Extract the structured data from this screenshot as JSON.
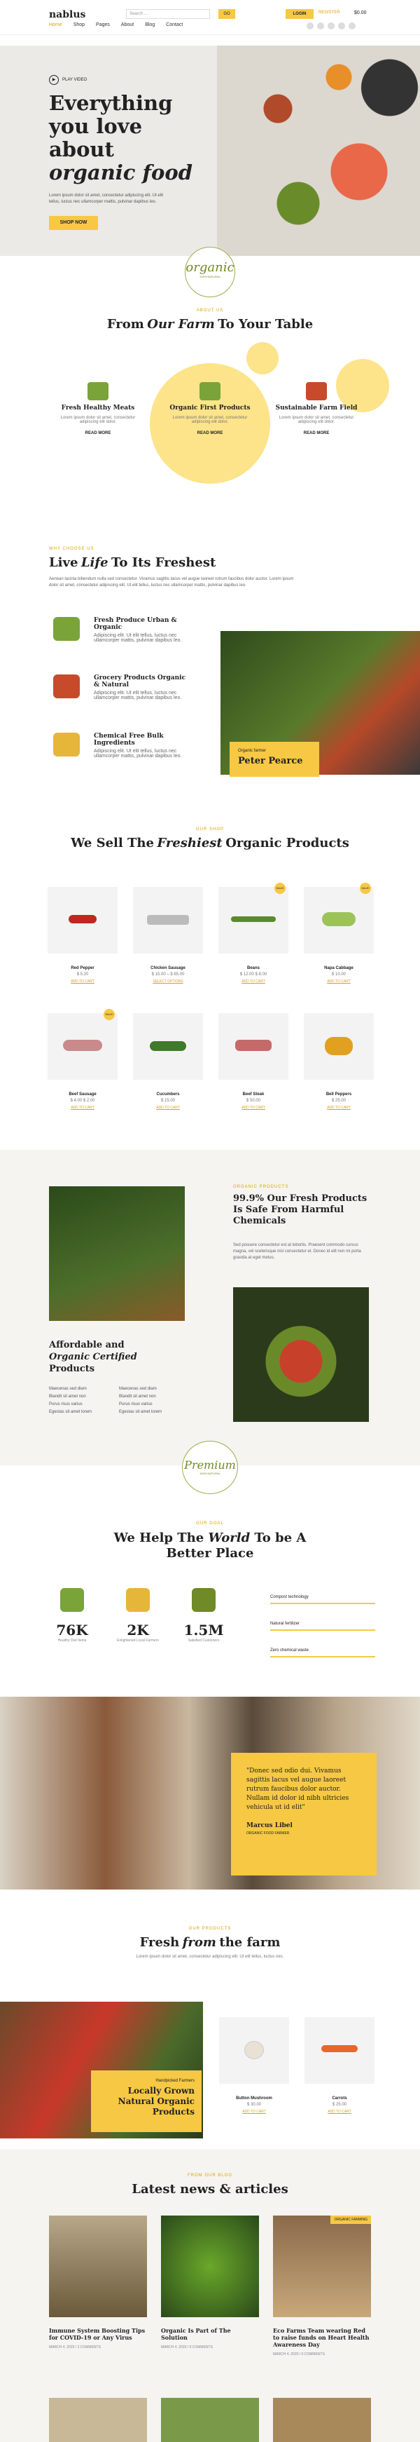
{
  "header": {
    "logo": "nablus",
    "search_placeholder": "Search ...",
    "search_btn": "GO",
    "login": "LOGIN",
    "register": "REGISTER",
    "cart": "$0.00",
    "menu": [
      "Home",
      "Shop",
      "Pages",
      "About",
      "Blog",
      "Contact"
    ]
  },
  "hero": {
    "play_label": "PLAY VIDEO",
    "title_lines": [
      "Everything",
      "you love",
      "about"
    ],
    "title_em": "organic food",
    "text": "Lorem ipsum dolor sit amet, consectetur adipiscing elit. Ut elit tellus, luctus nec ullamcorper mattis, pulvinar dapibus leo.",
    "cta": "SHOP NOW"
  },
  "badge": {
    "text": "organic",
    "sub": "100% NATURAL"
  },
  "farm": {
    "label": "ABOUT US",
    "title_a": "From",
    "title_em": "Our Farm",
    "title_b": "To Your Table",
    "cards": [
      {
        "title": "Fresh Healthy Meats",
        "text": "Lorem ipsum dolor sit amet, consectetur adipiscing elit dolor.",
        "more": "READ MORE"
      },
      {
        "title": "Organic First Products",
        "text": "Lorem ipsum dolor sit amet, consectetur adipiscing elit dolor.",
        "more": "READ MORE"
      },
      {
        "title": "Sustainable Farm Field",
        "text": "Lorem ipsum dolor sit amet, consectetur adipiscing elit dolor.",
        "more": "READ MORE"
      }
    ]
  },
  "life": {
    "label": "WHY CHOOSE US",
    "title_a": "Live",
    "title_em": "Life",
    "title_b": "To Its Freshest",
    "text": "Aenean lacinia bibendum nulla sed consectetur. Vivamus sagittis lacus vel augue laoreet rutrum faucibus dolor auctor. Lorem ipsum dolor sit amet, consectetur adipiscing elit. Ut elit tellus, luctus nec ullamcorper mattis, pulvinar dapibus leo.",
    "features": [
      {
        "title": "Fresh Produce Urban & Organic",
        "text": "Adipiscing elit. Ut elit tellus, luctus nec ullamcorper mattis, pulvinar dapibus leo."
      },
      {
        "title": "Grocery Products Organic & Natural",
        "text": "Adipiscing elit. Ut elit tellus, luctus nec ullamcorper mattis, pulvinar dapibus leo."
      },
      {
        "title": "Chemical Free Bulk Ingredients",
        "text": "Adipiscing elit. Ut elit tellus, luctus nec ullamcorper mattis, pulvinar dapibus leo."
      }
    ],
    "farmer_role": "Organic farmer",
    "farmer_name": "Peter Pearce"
  },
  "products": {
    "label": "OUR SHOP",
    "title_a": "We Sell The",
    "title_em": "Freshiest",
    "title_b": "Organic Products",
    "items": [
      {
        "name": "Red Pepper",
        "price": "$ 5.20",
        "add": "ADD TO CART"
      },
      {
        "name": "Chicken Sausage",
        "price": "$ 15.00 – $ 65.00",
        "add": "SELECT OPTIONS"
      },
      {
        "name": "Beans",
        "price": "$ 12.00 $ 8.00",
        "add": "ADD TO CART",
        "sale": "SALE!"
      },
      {
        "name": "Napa Cabbage",
        "price": "$ 10.00",
        "add": "ADD TO CART",
        "sale": "SALE!"
      },
      {
        "name": "Beef Sausage",
        "price": "$ 4.00 $ 2.00",
        "add": "ADD TO CART",
        "sale": "SALE!"
      },
      {
        "name": "Cucumbers",
        "price": "$ 15.00",
        "add": "ADD TO CART"
      },
      {
        "name": "Beef Steak",
        "price": "$ 50.00",
        "add": "ADD TO CART"
      },
      {
        "name": "Bell Peppers",
        "price": "$ 25.00",
        "add": "ADD TO CART"
      }
    ]
  },
  "fresh": {
    "label": "ORGANIC PRODUCTS",
    "title": "99.9% Our Fresh Products Is Safe From Harmful Chemicals",
    "text": "Sed posuere consectetur est at lobortis. Praesent commodo cursus magna, vel scelerisque nisl consectetur et. Donec id elit non mi porta gravida at eget metus.",
    "aff_title": "Affordable and",
    "aff_em": "Organic Certified",
    "aff_b": "Products",
    "list": [
      "Maecenas sed diam",
      "Blandit sit amet non",
      "Purus risus varius",
      "Egestas sit amet lorem",
      "Maecenas sed diam",
      "Blandit sit amet non",
      "Purus risus varius",
      "Egestas sit amet lorem"
    ]
  },
  "premium": {
    "text": "Premium",
    "sub": "100% NATURAL"
  },
  "help": {
    "label": "OUR GOAL",
    "title_a": "We Help The",
    "title_em": "World",
    "title_b": "To be A Better Place",
    "stats": [
      {
        "num": "76K",
        "label": "Healthy Diet Items"
      },
      {
        "num": "2K",
        "label": "Enlightened Local Farmers"
      },
      {
        "num": "1.5M",
        "label": "Satisfied Customers"
      }
    ],
    "bars": [
      "Compost technology",
      "Natural fertilizer",
      "Zero chemical waste"
    ]
  },
  "testimonial": {
    "quote": "\"Donec sed odio dui. Vivamus sagittis lacus vel augue laoreet rutrum faucibus dolor auctor. Nullam id dolor id nibh ultricies vehicula ut id elit\"",
    "name": "Marcus Libel",
    "role": "ORGANIC FOOD FARMER"
  },
  "farm2": {
    "label": "OUR PRODUCTS",
    "title_a": "Fresh",
    "title_em": "from",
    "title_b": "the farm",
    "text": "Lorem ipsum dolor sit amet, consectetur adipiscing elit. Ut elit tellus, luctus nec.",
    "hand": "Handpicked Farmers",
    "local": "Locally Grown Natural Organic Products",
    "items": [
      {
        "name": "Button Mushroom",
        "price": "$ 30.00",
        "add": "ADD TO CART"
      },
      {
        "name": "Carrots",
        "price": "$ 25.00",
        "add": "ADD TO CART"
      }
    ]
  },
  "news": {
    "label": "FROM OUR BLOG",
    "title": "Latest news & articles",
    "items": [
      {
        "title": "Immune System Boosting Tips for COVID-19 or Any Virus",
        "meta": "MARCH 4, 2020 / 2 COMMENTS",
        "tag": ""
      },
      {
        "title": "Organic Is Part of The Solution",
        "meta": "MARCH 4, 2020 / 0 COMMENTS",
        "tag": ""
      },
      {
        "title": "Eco Farms Team wearing Red to raise funds on Heart Health Awareness Day",
        "meta": "MARCH 4, 2020 / 0 COMMENTS",
        "tag": "ORGANIC FARMING"
      }
    ]
  },
  "colors": {
    "accent": "#f6c844",
    "accent_text": "#d9a300",
    "light_yellow": "#fde48a",
    "bg_grey": "#f5f4f1"
  }
}
